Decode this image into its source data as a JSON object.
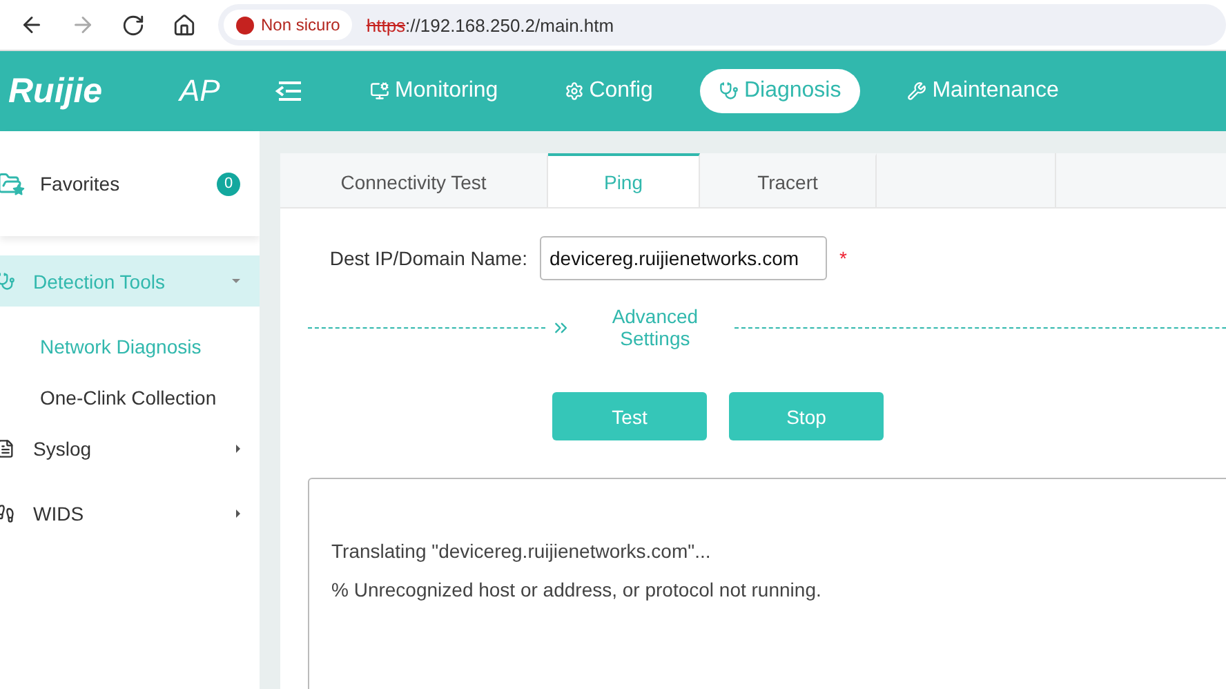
{
  "browser": {
    "security": "Non sicuro",
    "url_scheme": "https",
    "url_rest": "://192.168.250.2/main.htm"
  },
  "header": {
    "logo": "Ruijie",
    "product": "AP",
    "nav": [
      {
        "label": "Monitoring",
        "kind": "monitor",
        "selected": false
      },
      {
        "label": "Config",
        "kind": "gear",
        "selected": false
      },
      {
        "label": "Diagnosis",
        "kind": "stethoscope",
        "selected": true
      },
      {
        "label": "Maintenance",
        "kind": "tools",
        "selected": false
      }
    ]
  },
  "sidebar": {
    "favorites": {
      "label": "Favorites",
      "count": "0"
    },
    "items": [
      {
        "label": "Detection Tools",
        "kind": "stethoscope",
        "selected": true,
        "expanded": true,
        "children": [
          {
            "label": "Network Diagnosis",
            "selected": true
          },
          {
            "label": "One-Clink Collection",
            "selected": false
          }
        ]
      },
      {
        "label": "Syslog",
        "kind": "log",
        "selected": false,
        "expanded": false
      },
      {
        "label": "WIDS",
        "kind": "walker",
        "selected": false,
        "expanded": false
      }
    ]
  },
  "tabs": [
    {
      "label": "Connectivity Test",
      "selected": false
    },
    {
      "label": "Ping",
      "selected": true
    },
    {
      "label": "Tracert",
      "selected": false
    }
  ],
  "form": {
    "label": "Dest IP/Domain Name:",
    "value": "devicereg.ruijienetworks.com",
    "required_mark": "*",
    "advanced": "Advanced Settings",
    "buttons": [
      "Test",
      "Stop"
    ]
  },
  "output": [
    "Translating \"devicereg.ruijienetworks.com\"...",
    "% Unrecognized host or address, or protocol not running."
  ]
}
